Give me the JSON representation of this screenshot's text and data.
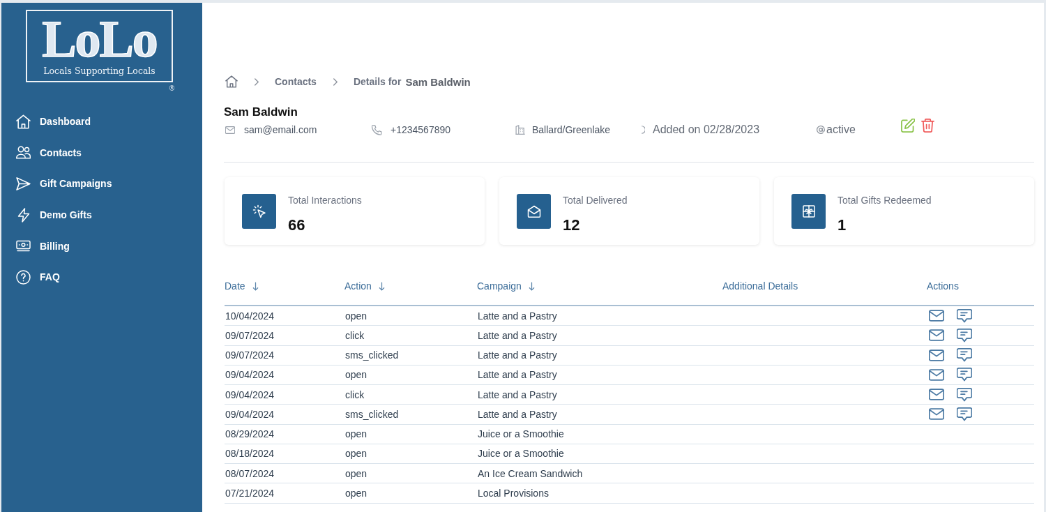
{
  "sidebar": {
    "logo": {
      "wordmark": "LoLo",
      "tagline": "Locals Supporting Locals",
      "registered_mark": "®"
    },
    "items": [
      {
        "label": "Dashboard"
      },
      {
        "label": "Contacts"
      },
      {
        "label": "Gift Campaigns"
      },
      {
        "label": "Demo Gifts"
      },
      {
        "label": "Billing"
      },
      {
        "label": "FAQ"
      }
    ]
  },
  "breadcrumb": {
    "links": [
      {
        "label": "Contacts"
      }
    ],
    "current_label": "Details for",
    "current_name": "Sam Baldwin"
  },
  "contact": {
    "name": "Sam Baldwin",
    "email": "sam@email.com",
    "phone": "+1234567890",
    "neighborhood": "Ballard/Greenlake",
    "added": "Added on 02/28/2023",
    "status": "active"
  },
  "stats": [
    {
      "label": "Total Interactions",
      "value": "66"
    },
    {
      "label": "Total Delivered",
      "value": "12"
    },
    {
      "label": "Total Gifts Redeemed",
      "value": "1"
    }
  ],
  "table": {
    "columns": [
      {
        "label": "Date",
        "sortable": true
      },
      {
        "label": "Action",
        "sortable": true
      },
      {
        "label": "Campaign",
        "sortable": true
      },
      {
        "label": "Additional Details",
        "sortable": false
      },
      {
        "label": "Actions",
        "sortable": false
      }
    ],
    "rows": [
      {
        "date": "10/04/2024",
        "action": "open",
        "campaign": "Latte and a Pastry",
        "message_actions": true
      },
      {
        "date": "09/07/2024",
        "action": "click",
        "campaign": "Latte and a Pastry",
        "message_actions": true
      },
      {
        "date": "09/07/2024",
        "action": "sms_clicked",
        "campaign": "Latte and a Pastry",
        "message_actions": true
      },
      {
        "date": "09/04/2024",
        "action": "open",
        "campaign": "Latte and a Pastry",
        "message_actions": true
      },
      {
        "date": "09/04/2024",
        "action": "click",
        "campaign": "Latte and a Pastry",
        "message_actions": true
      },
      {
        "date": "09/04/2024",
        "action": "sms_clicked",
        "campaign": "Latte and a Pastry",
        "message_actions": true
      },
      {
        "date": "08/29/2024",
        "action": "open",
        "campaign": "Juice or a Smoothie",
        "message_actions": false
      },
      {
        "date": "08/18/2024",
        "action": "open",
        "campaign": "Juice or a Smoothie",
        "message_actions": false
      },
      {
        "date": "08/07/2024",
        "action": "open",
        "campaign": "An Ice Cream Sandwich",
        "message_actions": false
      },
      {
        "date": "07/21/2024",
        "action": "open",
        "campaign": "Local Provisions",
        "message_actions": false
      }
    ]
  }
}
